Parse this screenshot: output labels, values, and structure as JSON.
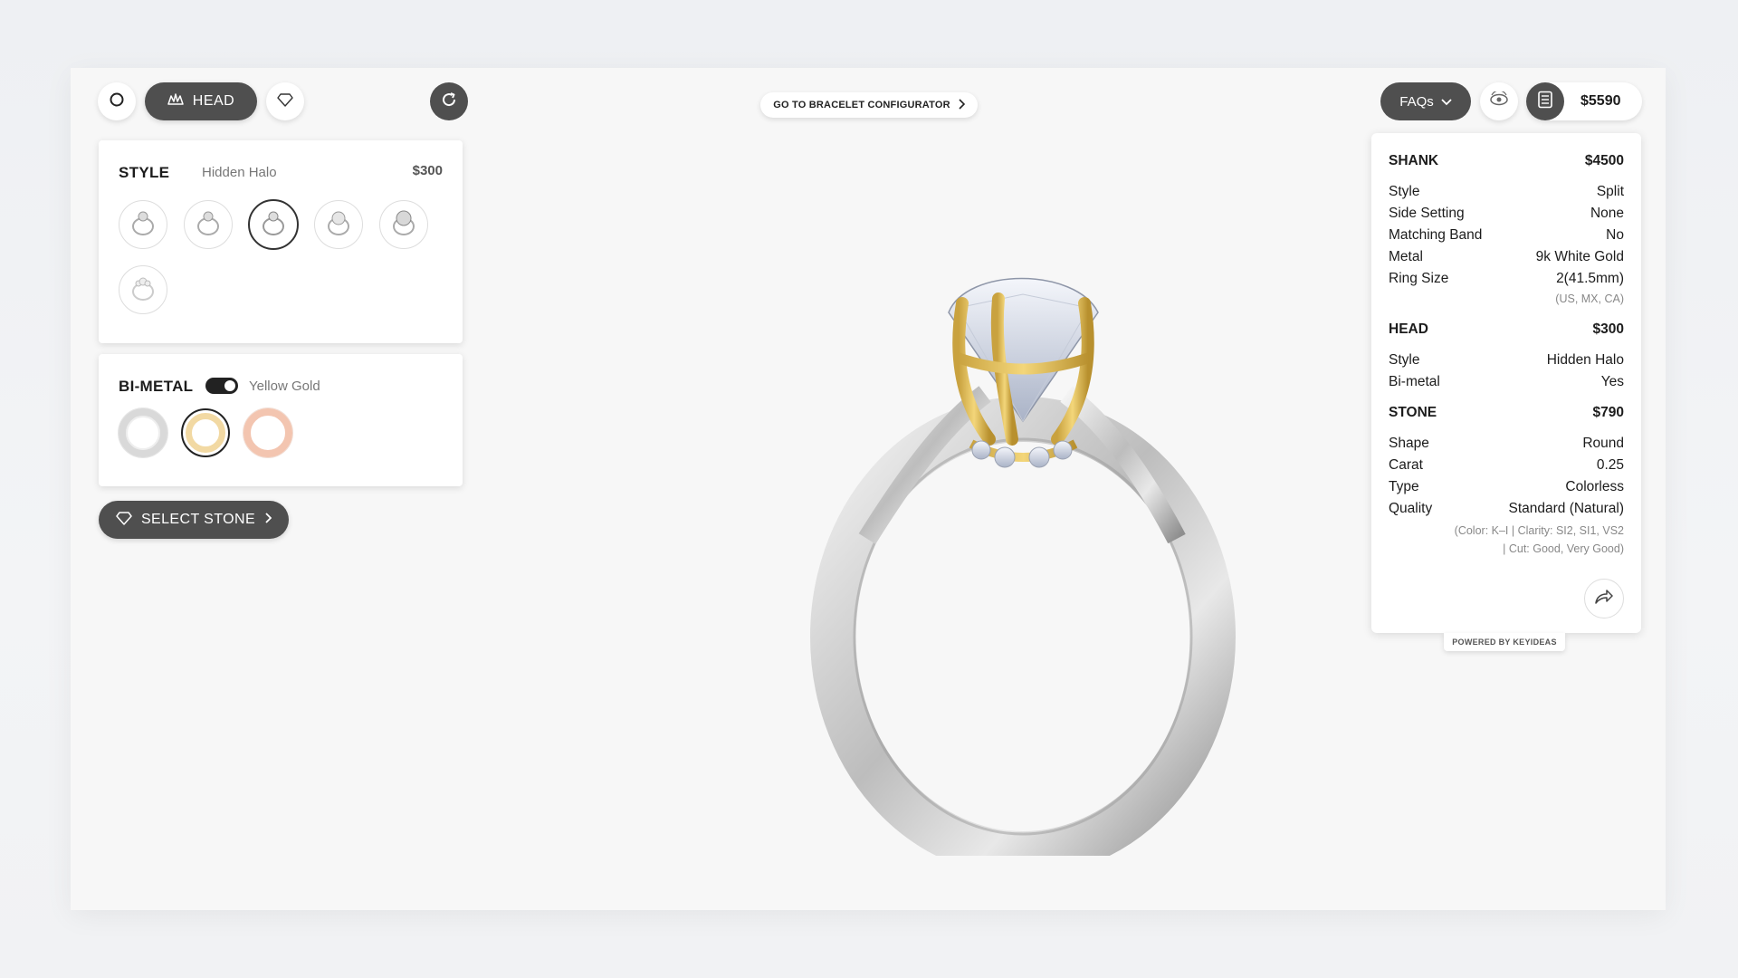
{
  "toolbar": {
    "shank_icon": "ring-outline-icon",
    "head_label": "HEAD",
    "stone_icon": "diamond-icon",
    "reset_icon": "refresh-icon"
  },
  "bracelet": {
    "label": "GO TO BRACELET CONFIGURATOR"
  },
  "style_card": {
    "title": "STYLE",
    "selected": "Hidden Halo",
    "price": "$300",
    "options": [
      "style-option-1",
      "style-option-2",
      "style-option-3",
      "style-option-4",
      "style-option-5",
      "style-option-6"
    ]
  },
  "bimetal_card": {
    "title": "BI-METAL",
    "toggle": "on",
    "selected": "Yellow Gold",
    "options": [
      "White Gold",
      "Yellow Gold",
      "Rose Gold"
    ]
  },
  "select_stone": {
    "label": "SELECT STONE"
  },
  "top_right": {
    "faqs_label": "FAQs",
    "total_price": "$5590"
  },
  "summary": {
    "shank": {
      "title": "SHANK",
      "price": "$4500",
      "rows": [
        {
          "k": "Style",
          "v": "Split"
        },
        {
          "k": "Side Setting",
          "v": "None"
        },
        {
          "k": "Matching Band",
          "v": "No"
        },
        {
          "k": "Metal",
          "v": "9k White Gold"
        },
        {
          "k": "Ring Size",
          "v": "2(41.5mm)"
        }
      ],
      "size_note": "(US, MX, CA)"
    },
    "head": {
      "title": "HEAD",
      "price": "$300",
      "rows": [
        {
          "k": "Style",
          "v": "Hidden Halo"
        },
        {
          "k": "Bi-metal",
          "v": "Yes"
        }
      ]
    },
    "stone": {
      "title": "STONE",
      "price": "$790",
      "rows": [
        {
          "k": "Shape",
          "v": "Round"
        },
        {
          "k": "Carat",
          "v": "0.25"
        },
        {
          "k": "Type",
          "v": "Colorless"
        },
        {
          "k": "Quality",
          "v": "Standard (Natural)"
        }
      ],
      "quality_note_1": "(Color: K–I | Clarity: SI2, SI1, VS2",
      "quality_note_2": "| Cut: Good, Very Good)"
    }
  },
  "powered_by": "POWERED BY KEYIDEAS",
  "colors": {
    "dark_button": "#4f4f4f",
    "white_gold": "#d9d9d9",
    "yellow_gold": "#f2d9a3",
    "rose_gold": "#f3c5b0"
  }
}
